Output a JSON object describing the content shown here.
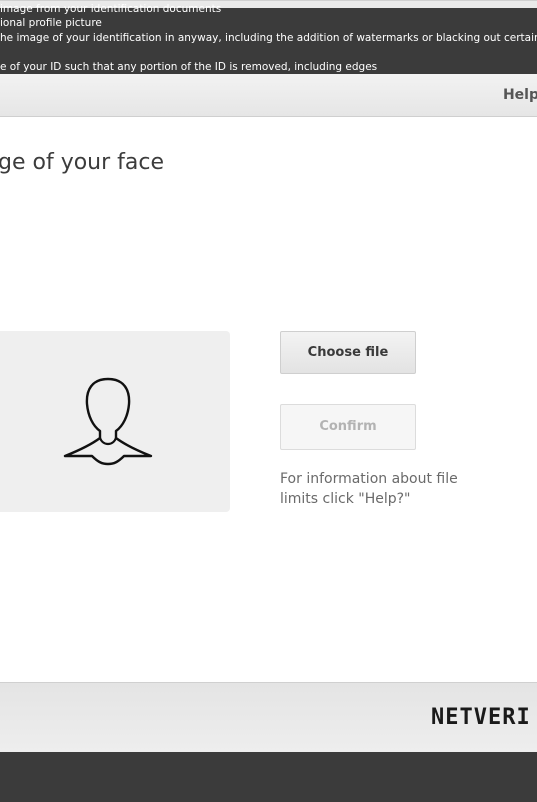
{
  "instructions": {
    "line1": "image from your identification documents",
    "line2": "ional profile picture",
    "line3": "he image of your identification in anyway, including the addition of watermarks or blacking out certain",
    "line4": "e of your ID such that any portion of the ID is removed, including edges"
  },
  "header": {
    "help_label": "Help"
  },
  "main": {
    "title": "ge of your face",
    "face_icon": "person-silhouette-icon",
    "choose_file_label": "Choose file",
    "confirm_label": "Confirm",
    "file_info": "For information about file limits click \"Help?\""
  },
  "footer": {
    "logo_text": "NETVERI"
  },
  "colors": {
    "dark_background": "#3b3b3b",
    "panel_background": "#ffffff",
    "help_text": "#555555",
    "disabled_text": "#b3b3b3"
  }
}
